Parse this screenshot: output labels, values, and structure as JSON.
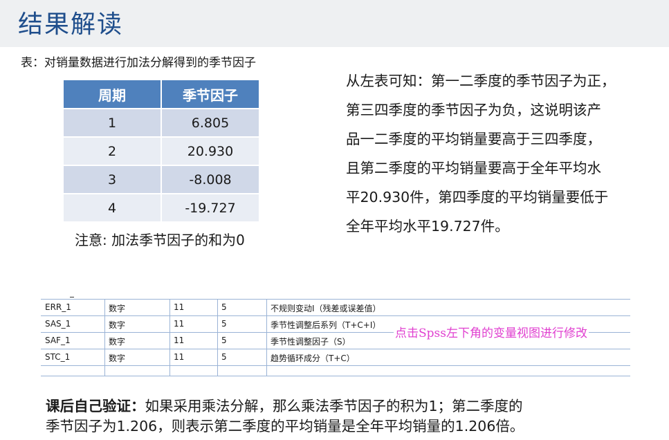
{
  "title": "结果解读",
  "caption": "表：对销量数据进行加法分解得到的季节因子",
  "table": {
    "headers": [
      "周期",
      "季节因子"
    ],
    "rows": [
      [
        "1",
        "6.805"
      ],
      [
        "2",
        "20.930"
      ],
      [
        "3",
        "-8.008"
      ],
      [
        "4",
        "-19.727"
      ]
    ],
    "header_color": "#4f81bd"
  },
  "note": "注意: 加法季节因子的和为0",
  "explanation_lines": [
    "从左表可知：第一二季度的季节因子为正，",
    "第三四季度的季节因子为负，这说明该产",
    "品一二季度的平均销量要高于三四季度，",
    "且第二季度的平均销量要高于全年平均水",
    "平20.930件，第四季度的平均销量要低于",
    "全年平均水平19.727件。"
  ],
  "variable_view": {
    "rows": [
      {
        "name": "ERR_1",
        "type": "数字",
        "width": "11",
        "decimals": "5",
        "label": "不规则变动I（残差或误差值）"
      },
      {
        "name": "SAS_1",
        "type": "数字",
        "width": "11",
        "decimals": "5",
        "label": "季节性调整后系列（T+C+I）"
      },
      {
        "name": "SAF_1",
        "type": "数字",
        "width": "11",
        "decimals": "5",
        "label": "季节性调整因子（S）"
      },
      {
        "name": "STC_1",
        "type": "数字",
        "width": "11",
        "decimals": "5",
        "label": "趋势循环成分（T+C）"
      }
    ],
    "overlay_note": "点击Spss左下角的变量视图进行修改",
    "overlay_color": "#e040d0"
  },
  "homework": {
    "bold_prefix": "课后自己验证：",
    "line1_rest": "如果采用乘法分解，那么乘法季节因子的积为1；第二季度的",
    "line2": "季节因子为1.206，则表示第二季度的平均销量是全年平均销量的1.206倍。"
  }
}
